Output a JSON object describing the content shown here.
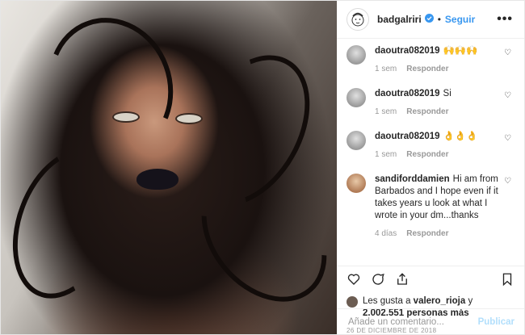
{
  "header": {
    "username": "badgalriri",
    "verified_icon": "verified-badge-icon",
    "separator": "•",
    "follow_label": "Seguir",
    "more_label": "•••"
  },
  "comments": [
    {
      "user": "daoutra082019",
      "text": "🙌🙌🙌",
      "time": "1 sem",
      "reply": "Responder",
      "avatar_color": "#b8b8b8"
    },
    {
      "user": "daoutra082019",
      "text": "Si",
      "time": "1 sem",
      "reply": "Responder",
      "avatar_color": "#b8b8b8"
    },
    {
      "user": "daoutra082019",
      "text": "👌👌👌",
      "time": "1 sem",
      "reply": "Responder",
      "avatar_color": "#b8b8b8"
    },
    {
      "user": "sandifordd​amien",
      "text": "Hi am from Barbados and I hope even if it takes years u look at what I wrote in your dm...thanks",
      "time": "4 días",
      "reply": "Responder",
      "avatar_color": "#c9a27c"
    }
  ],
  "likes": {
    "prefix": "Les gusta a",
    "user": "valero_rioja",
    "connector": "y",
    "count": "2.002.551 personas más"
  },
  "date": "26 DE DICIEMBRE DE 2018",
  "add_comment": {
    "placeholder": "Añade un comentario...",
    "publish_label": "Publicar"
  },
  "colors": {
    "accent": "#3897f0",
    "muted": "#999999",
    "publish_disabled": "#b2dffc"
  }
}
